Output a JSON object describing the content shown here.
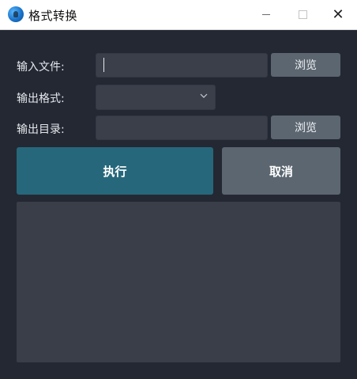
{
  "window": {
    "title": "格式转换",
    "icon": "app-globe-icon",
    "controls": {
      "minimize": "minimize-icon",
      "maximize": "maximize-icon",
      "close": "✕"
    }
  },
  "form": {
    "input_file": {
      "label": "输入文件:",
      "value": "",
      "browse_label": "浏览"
    },
    "output_format": {
      "label": "输出格式:",
      "selected": ""
    },
    "output_dir": {
      "label": "输出目录:",
      "value": "",
      "browse_label": "浏览"
    }
  },
  "actions": {
    "execute_label": "执行",
    "cancel_label": "取消"
  },
  "log": {
    "content": ""
  },
  "colors": {
    "background": "#232833",
    "field": "#3a3f4a",
    "execute": "#27677b",
    "secondary_button": "#5c6670",
    "text": "#e6e8ec"
  }
}
